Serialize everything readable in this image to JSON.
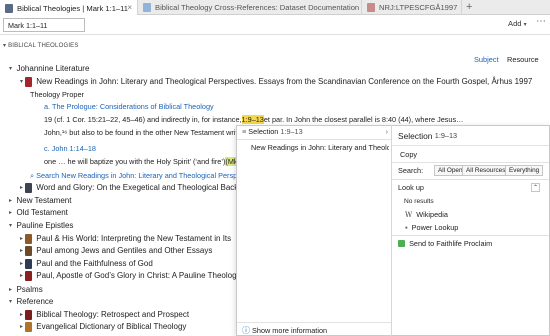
{
  "tabs": [
    {
      "label": "Biblical Theologies | Mark 1:1–11",
      "active": true
    },
    {
      "label": "Biblical Theology Cross-References: Dataset Documentation",
      "active": false
    },
    {
      "label": "NRJ:LTPESCFGÅ1997",
      "active": false
    }
  ],
  "toolbar": {
    "reference_value": "Mark 1:1–11",
    "add_label": "Add",
    "more": "⋯"
  },
  "panel": {
    "section_label": "BIBLICAL THEOLOGIES",
    "subject_label": "Subject",
    "resource_label": "Resource"
  },
  "tree": {
    "johannine": "Johannine Literature",
    "resource_title": "New Readings in John: Literary and Theological Perspectives. Essays from the Scandinavian Conference on the Fourth Gospel, Århus 1997",
    "theology_proper": "Theology Proper",
    "prologue_link": "a. The Prologue: Considerations of Biblical Theology",
    "line1_a": "19 (cf. 1 Cor. 15:21–22, 45–46) and indirectly in, for instance, ",
    "line1_hl": "1:9–13",
    "line1_b": " et par. In John the closest parallel is 8:40 (44), where Jesus…",
    "line2": "John,¹⁶ but also to be found in the other New Testament writing",
    "john_link": "c. John 1:14–18",
    "line3_a": "one … he will baptize you with the Holy Spirit’ (‘and fire’) ",
    "line3_hl": "(Mk 1",
    "search_link": "Search New Readings in John: Literary and Theological Perspect",
    "word_glory": "Word and Glory: On the Exegetical and Theological Back",
    "new_testament": "New Testament",
    "old_testament": "Old Testament",
    "pauline": "Pauline Epistles",
    "pauline_items": [
      "Paul & His World: Interpreting the New Testament in Its",
      "Paul among Jews and Gentiles and Other Essays",
      "Paul and the Faithfulness of God",
      "Paul, Apostle of God’s Glory in Christ: A Pauline Theolog"
    ],
    "psalms": "Psalms",
    "reference": "Reference",
    "reference_items": [
      "Biblical Theology: Retrospect and Prospect",
      "Evangelical Dictionary of Biblical Theology"
    ]
  },
  "popup": {
    "selection_menu_label": "Selection",
    "selection_menu_value": "1:9–13",
    "menu_resource": "New Readings in John: Literary and Theolo…",
    "show_more": "Show more information",
    "selection_title": "Selection",
    "selection_value": "1:9–13",
    "copy": "Copy",
    "search_label": "Search:",
    "search_chips": [
      "All Open",
      "All Resources",
      "Everything"
    ],
    "lookup": "Look up",
    "no_results": "No results",
    "lookup_items": [
      "Wikipedia",
      "Power Lookup"
    ],
    "send": "Send to Faithlife Proclaim"
  },
  "colors": {
    "link": "#1b64b8",
    "highlight": "#f5d84a",
    "book_red": "#a3262a",
    "book_dark": "#3d4350"
  }
}
